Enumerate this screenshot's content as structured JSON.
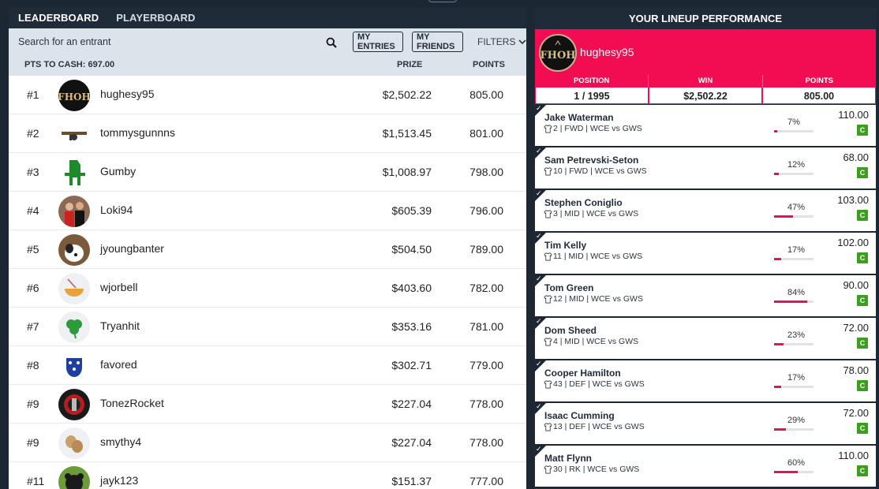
{
  "left": {
    "tabs": [
      "LEADERBOARD",
      "PLAYERBOARD"
    ],
    "search_placeholder": "Search for an entrant",
    "my_entries": "MY ENTRIES",
    "my_friends": "MY FRIENDS",
    "filters": "FILTERS",
    "pts_to_cash": "PTS TO CASH: 697.00",
    "col_prize": "PRIZE",
    "col_points": "POINTS",
    "rows": [
      {
        "rank": "#1",
        "name": "hughesy95",
        "prize": "$2,502.22",
        "points": "805.00",
        "avatar": "fhoh-logo-icon"
      },
      {
        "rank": "#2",
        "name": "tommysgunnns",
        "prize": "$1,513.45",
        "points": "801.00",
        "avatar": "tommy-gun-icon"
      },
      {
        "rank": "#3",
        "name": "Gumby",
        "prize": "$1,008.97",
        "points": "798.00",
        "avatar": "gumby-icon"
      },
      {
        "rank": "#4",
        "name": "Loki94",
        "prize": "$605.39",
        "points": "796.00",
        "avatar": "people-photo-icon"
      },
      {
        "rank": "#5",
        "name": "jyoungbanter",
        "prize": "$504.50",
        "points": "789.00",
        "avatar": "dog-photo-icon"
      },
      {
        "rank": "#6",
        "name": "wjorbell",
        "prize": "$403.60",
        "points": "782.00",
        "avatar": "noodle-bowl-icon"
      },
      {
        "rank": "#7",
        "name": "Tryanhit",
        "prize": "$353.16",
        "points": "781.00",
        "avatar": "clover-icon"
      },
      {
        "rank": "#8",
        "name": "favored",
        "prize": "$302.71",
        "points": "779.00",
        "avatar": "crest-icon"
      },
      {
        "rank": "#9",
        "name": "TonezRocket",
        "prize": "$227.04",
        "points": "778.00",
        "avatar": "rocket-logo-icon"
      },
      {
        "rank": "#9",
        "name": "smythy4",
        "prize": "$227.04",
        "points": "778.00",
        "avatar": "peanut-icon"
      },
      {
        "rank": "#11",
        "name": "jayk123",
        "prize": "$151.37",
        "points": "777.00",
        "avatar": "bear-photo-icon"
      }
    ]
  },
  "right": {
    "title": "YOUR LINEUP PERFORMANCE",
    "username": "hughesy95",
    "stats_labels": [
      "POSITION",
      "WIN",
      "POINTS"
    ],
    "stats_values": [
      "1 / 1995",
      "$2,502.22",
      "805.00"
    ],
    "players": [
      {
        "name": "Jake Waterman",
        "info": "2 | FWD | WCE vs GWS",
        "pct": "7%",
        "pct_value": 7,
        "points": "110.00",
        "badge": "C"
      },
      {
        "name": "Sam Petrevski-Seton",
        "info": "10 | FWD | WCE vs GWS",
        "pct": "12%",
        "pct_value": 12,
        "points": "68.00",
        "badge": "C"
      },
      {
        "name": "Stephen Coniglio",
        "info": "3 | MID | WCE vs GWS",
        "pct": "47%",
        "pct_value": 47,
        "points": "103.00",
        "badge": "C"
      },
      {
        "name": "Tim Kelly",
        "info": "11 | MID | WCE vs GWS",
        "pct": "17%",
        "pct_value": 17,
        "points": "102.00",
        "badge": "C"
      },
      {
        "name": "Tom Green",
        "info": "12 | MID | WCE vs GWS",
        "pct": "84%",
        "pct_value": 84,
        "points": "90.00",
        "badge": "C"
      },
      {
        "name": "Dom Sheed",
        "info": "4 | MID | WCE vs GWS",
        "pct": "23%",
        "pct_value": 23,
        "points": "72.00",
        "badge": "C"
      },
      {
        "name": "Cooper Hamilton",
        "info": "43 | DEF | WCE vs GWS",
        "pct": "17%",
        "pct_value": 17,
        "points": "78.00",
        "badge": "C"
      },
      {
        "name": "Isaac Cumming",
        "info": "13 | DEF | WCE vs GWS",
        "pct": "29%",
        "pct_value": 29,
        "points": "72.00",
        "badge": "C"
      },
      {
        "name": "Matt Flynn",
        "info": "30 | RK | WCE vs GWS",
        "pct": "60%",
        "pct_value": 60,
        "points": "110.00",
        "badge": "C"
      }
    ]
  },
  "colors": {
    "accent": "#f20c52",
    "dark": "#1f2b38",
    "badge": "#3c9e1e"
  }
}
